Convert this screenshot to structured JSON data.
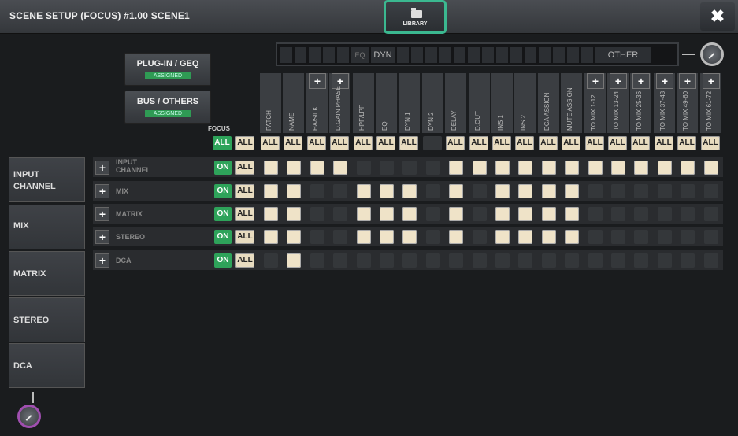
{
  "window": {
    "title": "SCENE SETUP (FOCUS) #1.00 SCENE1",
    "close_label": "✖"
  },
  "library": {
    "label": "LIBRARY"
  },
  "strip": {
    "segments": [
      "..",
      "..",
      "..",
      "..",
      "..",
      "EQ",
      "DYN",
      "..",
      "..",
      "..",
      "..",
      "..",
      "..",
      "..",
      "..",
      "..",
      "..",
      "..",
      "..",
      "..",
      "..",
      "OTHER"
    ]
  },
  "plugin_button": {
    "label": "PLUG-IN / GEQ",
    "badge": "ASSIGNED"
  },
  "bus_button": {
    "label": "BUS / OTHERS",
    "badge": "ASSIGNED"
  },
  "focus_label": "FOCUS",
  "all_label": "ALL",
  "on_label": "ON",
  "plus_label": "+",
  "columns": [
    {
      "label": "PATCH",
      "plus": false
    },
    {
      "label": "NAME",
      "plus": false
    },
    {
      "label": "HA/SILK",
      "plus": true
    },
    {
      "label": "D.GAIN PHASE",
      "plus": true
    },
    {
      "label": "HPF/LPF",
      "plus": false
    },
    {
      "label": "EQ",
      "plus": false
    },
    {
      "label": "DYN 1",
      "plus": false
    },
    {
      "label": "DYN 2",
      "plus": false
    },
    {
      "label": "DELAY",
      "plus": false
    },
    {
      "label": "D.OUT",
      "plus": false
    },
    {
      "label": "INS 1",
      "plus": false
    },
    {
      "label": "INS 2",
      "plus": false
    },
    {
      "label": "DCA ASSIGN",
      "plus": false
    },
    {
      "label": "MUTE ASSIGN",
      "plus": false
    },
    {
      "label": "TO MIX 1-12",
      "plus": true
    },
    {
      "label": "TO MIX 13-24",
      "plus": true
    },
    {
      "label": "TO MIX 25-36",
      "plus": true
    },
    {
      "label": "TO MIX 37-48",
      "plus": true
    },
    {
      "label": "TO MIX 49-60",
      "plus": true
    },
    {
      "label": "TO MIX 61-72",
      "plus": true
    }
  ],
  "column_all": [
    true,
    true,
    true,
    true,
    true,
    true,
    true,
    false,
    true,
    true,
    true,
    true,
    true,
    true,
    true,
    true,
    true,
    true,
    true,
    true
  ],
  "rows": [
    {
      "label": "INPUT CHANNEL",
      "cells": [
        1,
        1,
        1,
        1,
        0,
        0,
        0,
        0,
        1,
        1,
        1,
        1,
        1,
        1,
        1,
        1,
        1,
        1,
        1,
        1
      ]
    },
    {
      "label": "MIX",
      "cells": [
        1,
        1,
        0,
        0,
        1,
        1,
        1,
        0,
        1,
        0,
        1,
        1,
        1,
        1,
        0,
        0,
        0,
        0,
        0,
        0
      ]
    },
    {
      "label": "MATRIX",
      "cells": [
        1,
        1,
        0,
        0,
        1,
        1,
        1,
        0,
        1,
        0,
        1,
        1,
        1,
        1,
        0,
        0,
        0,
        0,
        0,
        0
      ]
    },
    {
      "label": "STEREO",
      "cells": [
        1,
        1,
        0,
        0,
        1,
        1,
        1,
        0,
        1,
        0,
        1,
        1,
        1,
        1,
        0,
        0,
        0,
        0,
        0,
        0
      ]
    },
    {
      "label": "DCA",
      "cells": [
        0,
        1,
        0,
        0,
        0,
        0,
        0,
        0,
        0,
        0,
        0,
        0,
        0,
        0,
        0,
        0,
        0,
        0,
        0,
        0
      ]
    }
  ],
  "sidebar": {
    "items": [
      {
        "label": "INPUT CHANNEL"
      },
      {
        "label": "MIX"
      },
      {
        "label": "MATRIX"
      },
      {
        "label": "STEREO"
      },
      {
        "label": "DCA"
      }
    ]
  },
  "colors": {
    "accent_green": "#2ea35a",
    "library_border": "#3bb890",
    "knob_purple": "#a04fb0"
  }
}
